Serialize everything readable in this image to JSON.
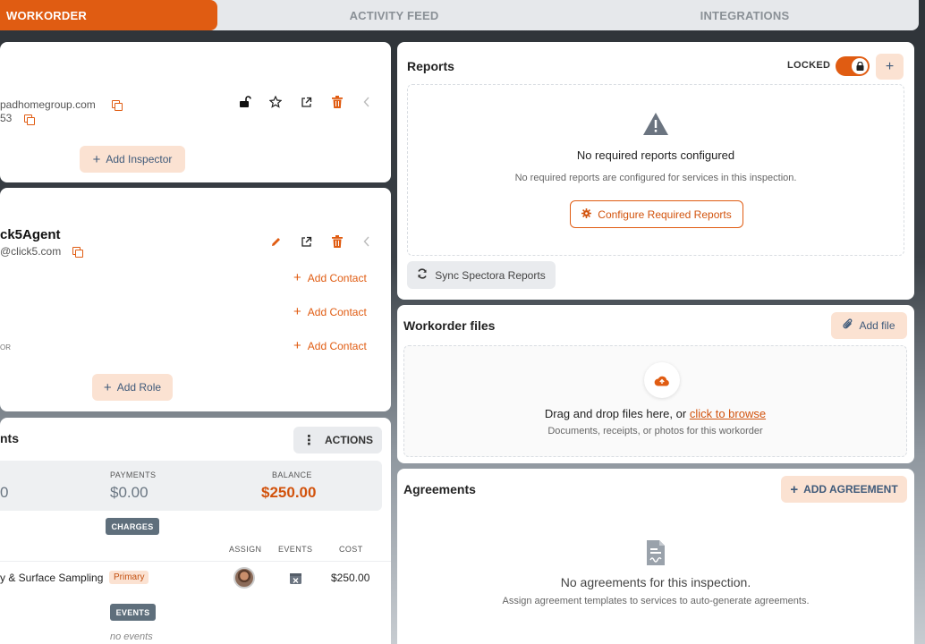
{
  "tabs": [
    "WORKORDER",
    "ACTIVITY FEED",
    "INTEGRATIONS"
  ],
  "inspector": {
    "email": "padhomegroup.com",
    "phone_fragment": "53",
    "add_label": "Add Inspector"
  },
  "agent": {
    "name": "ck5Agent",
    "email": "@click5.com",
    "add_contact_label": "Add Contact",
    "row_fragment": "OR",
    "add_role_label": "Add Role"
  },
  "payments": {
    "title_fragment": "nts",
    "actions_label": "ACTIONS",
    "left_amount_fragment": "0",
    "payments_label": "PAYMENTS",
    "payments_value": "$0.00",
    "balance_label": "BALANCE",
    "balance_value": "$250.00",
    "charges_label": "CHARGES",
    "col_assign": "ASSIGN",
    "col_events": "EVENTS",
    "col_cost": "COST",
    "service_name": "y & Surface Sampling",
    "service_badge": "Primary",
    "service_cost": "$250.00",
    "events_label": "EVENTS",
    "no_events": "no events"
  },
  "reports": {
    "title": "Reports",
    "locked_label": "LOCKED",
    "empty_title": "No required reports configured",
    "empty_sub": "No required reports are configured for services in this inspection.",
    "configure_label": "Configure Required Reports",
    "sync_label": "Sync Spectora Reports"
  },
  "files": {
    "title": "Workorder files",
    "add_label": "Add file",
    "drop_text": "Drag and drop files here, or",
    "browse_link": "click to browse",
    "drop_sub": "Documents, receipts, or photos for this workorder"
  },
  "agreements": {
    "title": "Agreements",
    "add_label": "ADD AGREEMENT",
    "empty_title": "No agreements for this inspection.",
    "empty_sub": "Assign agreement templates to services to auto-generate agreements."
  },
  "colors": {
    "accent": "#e05c12",
    "accent_soft": "#fbe2d2",
    "slate": "#5f6f7c"
  }
}
